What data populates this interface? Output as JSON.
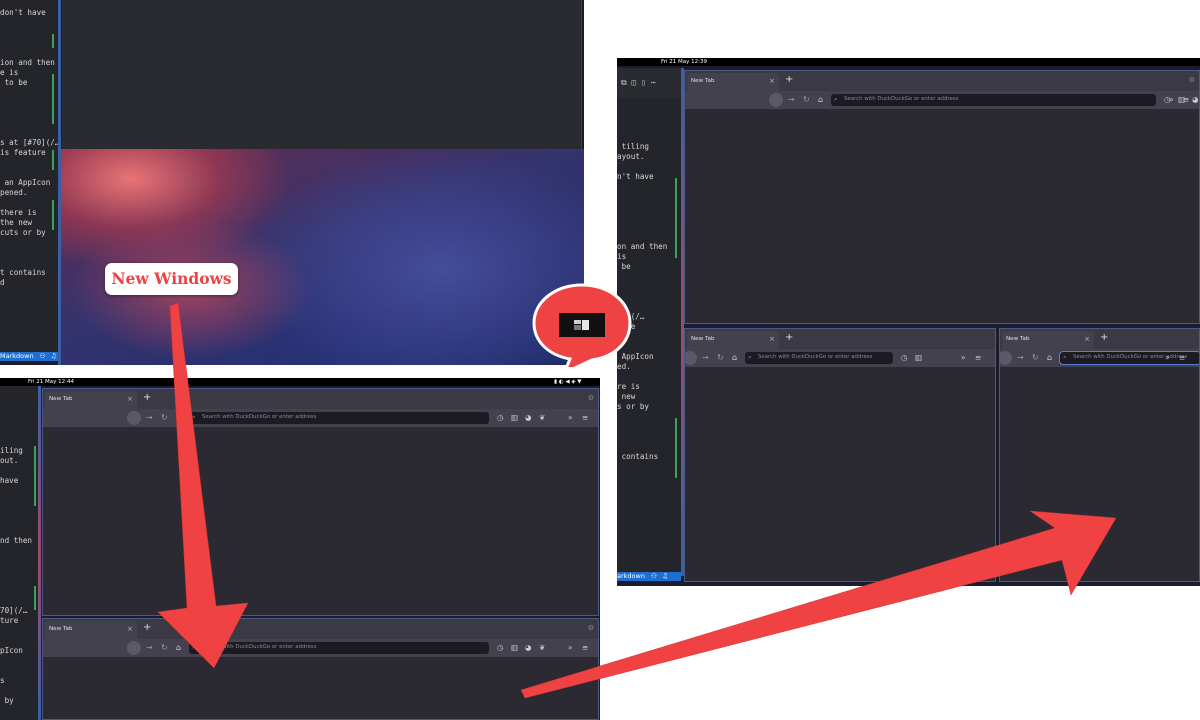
{
  "panel_top_left": {
    "editor_lines": [
      "don't have",
      "",
      "",
      "",
      "",
      "ion and then",
      "e is",
      " to be",
      "",
      "",
      "",
      "",
      "",
      "s at [#70](/…",
      "is feature",
      "",
      "",
      " an AppIcon",
      "pened.",
      "",
      "there is",
      "the new",
      "cuts or by",
      "",
      "",
      "",
      "t contains",
      "d"
    ],
    "status_label": "Markdown"
  },
  "callout_label": "New Windows",
  "panel_bottom_left": {
    "clock": "Fri 21 May 12:44",
    "editor_lines": [
      "",
      "",
      "",
      "",
      "iling",
      "out.",
      "",
      "have",
      "",
      "",
      "",
      "",
      "",
      "nd then",
      "",
      "",
      "",
      "",
      "",
      "",
      "70](/…",
      "ture",
      "",
      "",
      "pIcon",
      "",
      "",
      "s",
      "",
      " by"
    ]
  },
  "panel_right": {
    "clock": "Fri 21 May 12:39",
    "editor_lines": [
      "",
      "",
      "",
      "",
      " tiling",
      "ayout.",
      "",
      "n't have",
      "",
      "",
      "",
      "",
      "",
      "",
      "on and then",
      "is",
      " be",
      "",
      "",
      "",
      "",
      "70](/…",
      "ture",
      "",
      "",
      " AppIcon",
      "ed.",
      "",
      "re is",
      " new",
      "s or by",
      "",
      "",
      "",
      "",
      " contains"
    ],
    "status_label": "arkdown"
  },
  "browser": {
    "tab_label": "New Tab",
    "tab_close": "×",
    "new_tab": "+",
    "url_placeholder": "Search with DuckDuckGo or enter address",
    "back": "←",
    "forward": "→",
    "reload": "↻",
    "home": "⌂",
    "search_glyph": "⌕",
    "menu_glyph": "≡",
    "overflow_glyph": "»"
  },
  "colors": {
    "arrow": "#f04242",
    "accent_blue": "#1f6fd1",
    "browser_bg": "#2b2a33",
    "callout_red": "#ef4343"
  }
}
